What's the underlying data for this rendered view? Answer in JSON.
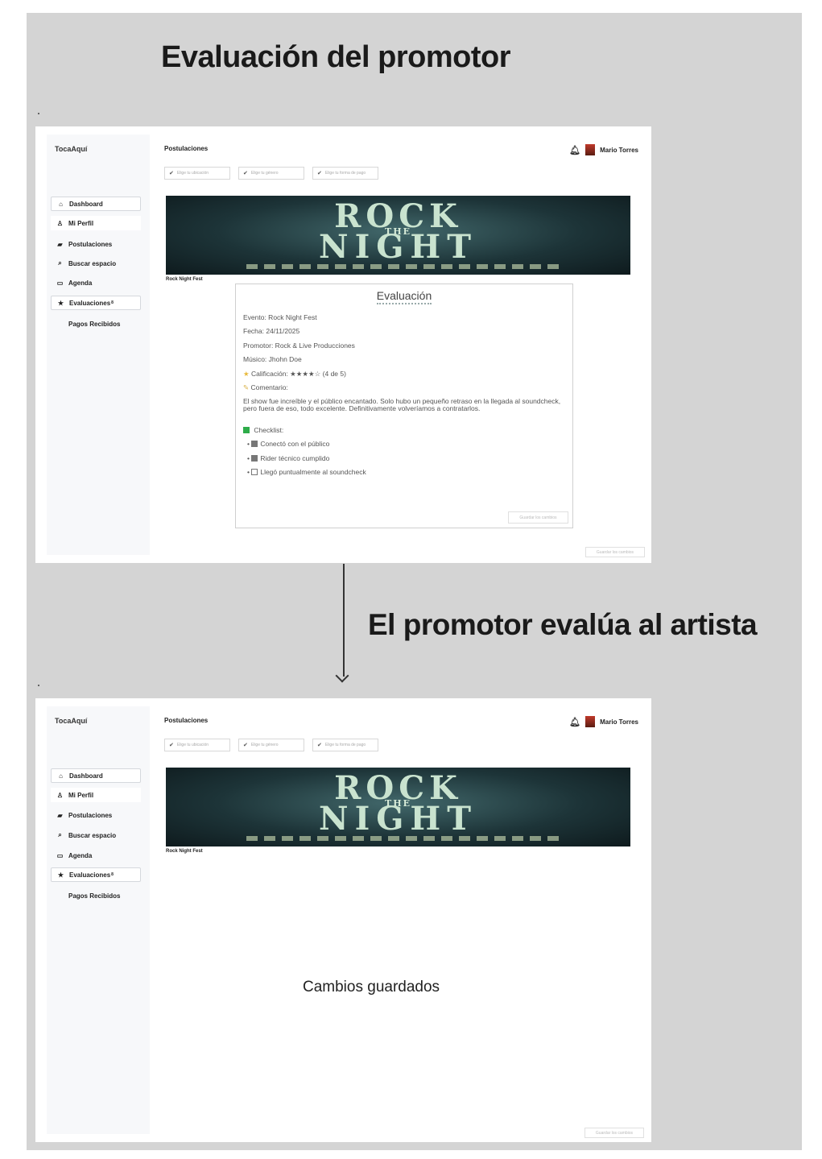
{
  "headings": {
    "main_title": "Evaluación del promotor",
    "flow_label": "El promotor evalúa al artista"
  },
  "app": {
    "brand": "TocaAquí",
    "section_title": "Postulaciones",
    "user_name": "Mario Torres",
    "filters": [
      "Elige tu ubicación",
      "Elige tu género",
      "Elige tu forma de pago"
    ],
    "sidebar": [
      {
        "label": "Dashboard",
        "icon": "home-icon"
      },
      {
        "label": "Mi Perfil",
        "icon": "user-icon"
      },
      {
        "label": "Postulaciones",
        "icon": "folder-icon"
      },
      {
        "label": "Buscar espacio",
        "icon": "search-icon"
      },
      {
        "label": "Agenda",
        "icon": "calendar-icon"
      },
      {
        "label": "Evaluaciones",
        "icon": "star-icon",
        "badge": "8"
      },
      {
        "label": "Pagos Recibidos",
        "icon": "money-icon"
      }
    ],
    "banner": {
      "line1": "ROCK",
      "line2": "THE",
      "line3": "NIGHT",
      "caption": "Rock Night Fest"
    }
  },
  "evaluation": {
    "title": "Evaluación",
    "event": "Evento: Rock Night Fest",
    "date": "Fecha: 24/11/2025",
    "promoter": "Promotor: Rock & Live Producciones",
    "musician": "Músico: Jhohn Doe",
    "rating": "Calificación: ★★★★☆ (4 de 5)",
    "comment_label": "Comentario:",
    "comment": "El show fue increíble y el público encantado. Solo hubo un pequeño retraso en la llegada al soundcheck, pero fuera de eso, todo excelente. Definitivamente volveríamos a contratarlos.",
    "checklist_label": "Checklist:",
    "checklist": [
      {
        "label": "Conectó con el público",
        "checked": true
      },
      {
        "label": "Rider técnico cumplido",
        "checked": true
      },
      {
        "label": "Llegó puntualmente al soundcheck",
        "checked": false
      }
    ],
    "save_button": "Guardar los cambios"
  },
  "saved_message": "Cambios guardados",
  "colors": {
    "board": "#d4d4d4",
    "banner_dark": "#1d3438",
    "banner_text": "#c9e3cf",
    "check_green": "#2eac4a"
  }
}
